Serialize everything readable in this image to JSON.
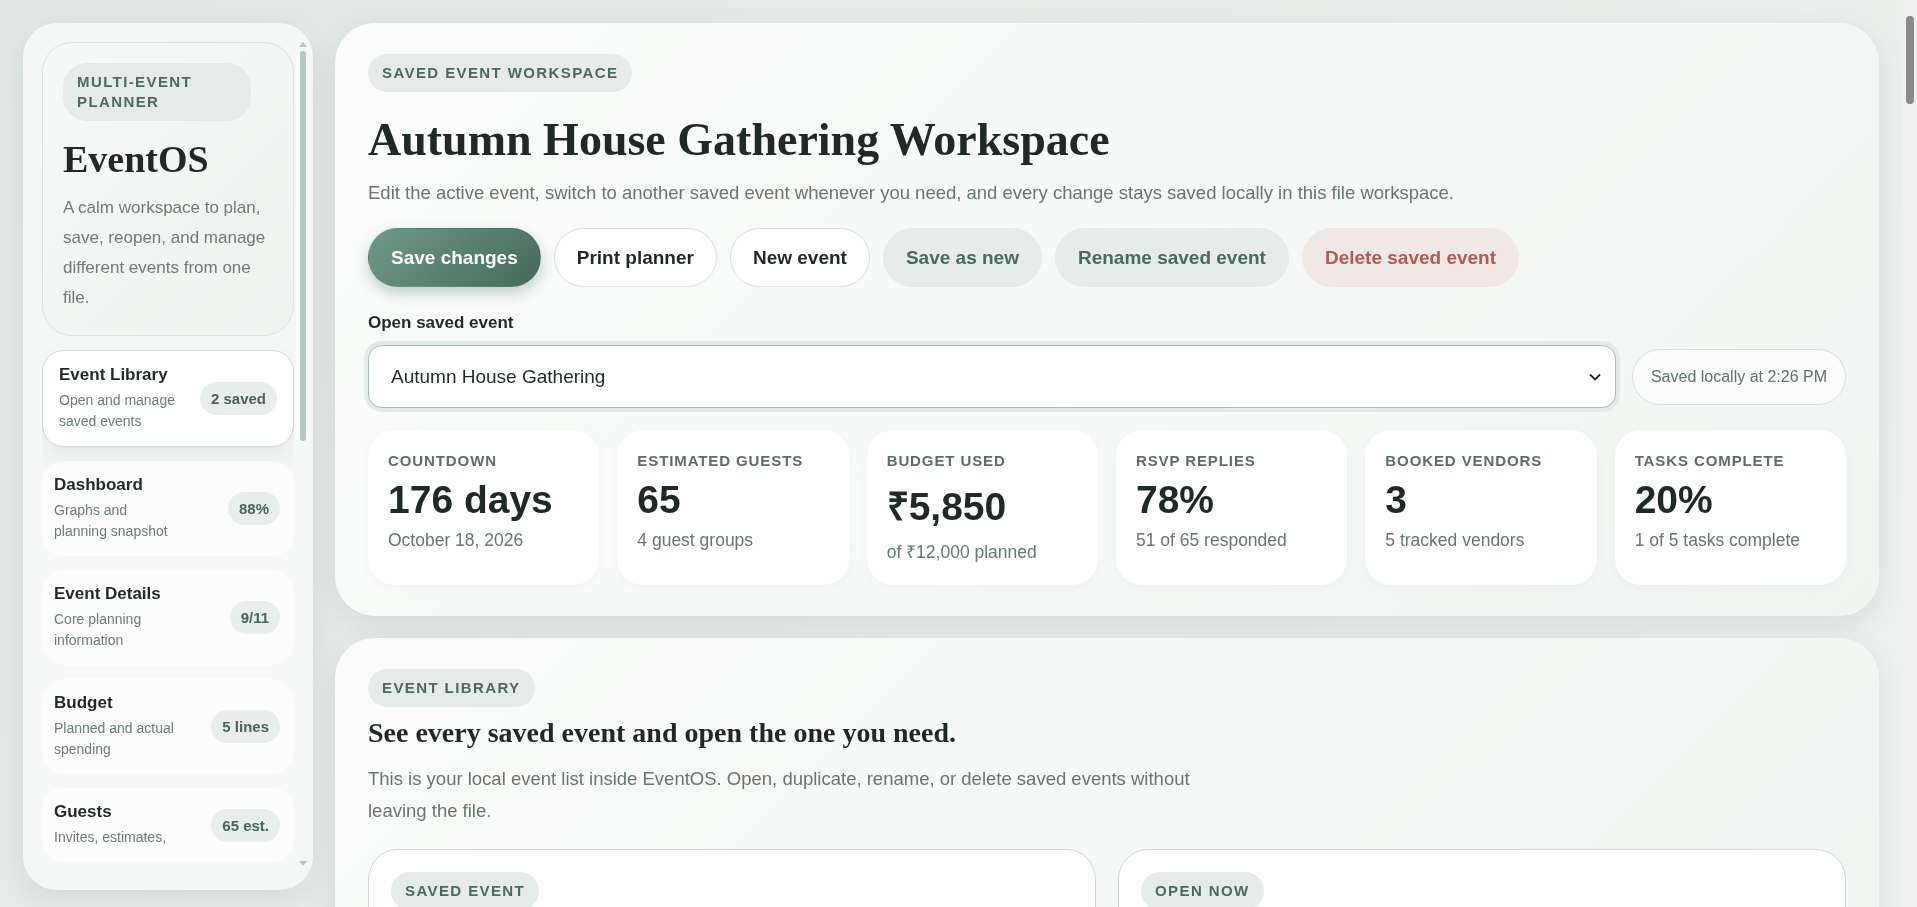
{
  "sidebar": {
    "eyebrow": "MULTI-EVENT PLANNER",
    "brand": "EventOS",
    "tagline": "A calm workspace to plan, save, reopen, and manage different events from one file.",
    "items": [
      {
        "title": "Event Library",
        "desc": "Open and manage saved events",
        "badge": "2 saved",
        "selected": true
      },
      {
        "title": "Dashboard",
        "desc": "Graphs and planning snapshot",
        "badge": "88%",
        "selected": false
      },
      {
        "title": "Event Details",
        "desc": "Core planning information",
        "badge": "9/11",
        "selected": false
      },
      {
        "title": "Budget",
        "desc": "Planned and actual spending",
        "badge": "5 lines",
        "selected": false
      },
      {
        "title": "Guests",
        "desc": "Invites, estimates,",
        "badge": "65 est.",
        "selected": false
      }
    ]
  },
  "workspace": {
    "eyebrow": "SAVED EVENT WORKSPACE",
    "title": "Autumn House Gathering Workspace",
    "subtitle": "Edit the active event, switch to another saved event whenever you need, and every change stays saved locally in this file workspace.",
    "buttons": [
      {
        "label": "Save changes",
        "kind": "primary"
      },
      {
        "label": "Print planner",
        "kind": "outline"
      },
      {
        "label": "New event",
        "kind": "outline"
      },
      {
        "label": "Save as new",
        "kind": "soft"
      },
      {
        "label": "Rename saved event",
        "kind": "soft"
      },
      {
        "label": "Delete saved event",
        "kind": "danger"
      }
    ],
    "select_label": "Open saved event",
    "select_value": "Autumn House Gathering",
    "save_status": "Saved locally at 2:26 PM",
    "stats": [
      {
        "label": "COUNTDOWN",
        "value": "176 days",
        "note": "October 18, 2026"
      },
      {
        "label": "ESTIMATED GUESTS",
        "value": "65",
        "note": "4 guest groups"
      },
      {
        "label": "BUDGET USED",
        "value": "₹5,850",
        "note": "of ₹12,000 planned"
      },
      {
        "label": "RSVP REPLIES",
        "value": "78%",
        "note": "51 of 65 responded"
      },
      {
        "label": "BOOKED VENDORS",
        "value": "3",
        "note": "5 tracked vendors"
      },
      {
        "label": "TASKS COMPLETE",
        "value": "20%",
        "note": "1 of 5 tasks complete"
      }
    ]
  },
  "library": {
    "eyebrow": "EVENT LIBRARY",
    "title": "See every saved event and open the one you need.",
    "text": "This is your local event list inside EventOS. Open, duplicate, rename, or delete saved events without leaving the file.",
    "cards": [
      {
        "tag": "SAVED EVENT"
      },
      {
        "tag": "OPEN NOW"
      }
    ]
  }
}
